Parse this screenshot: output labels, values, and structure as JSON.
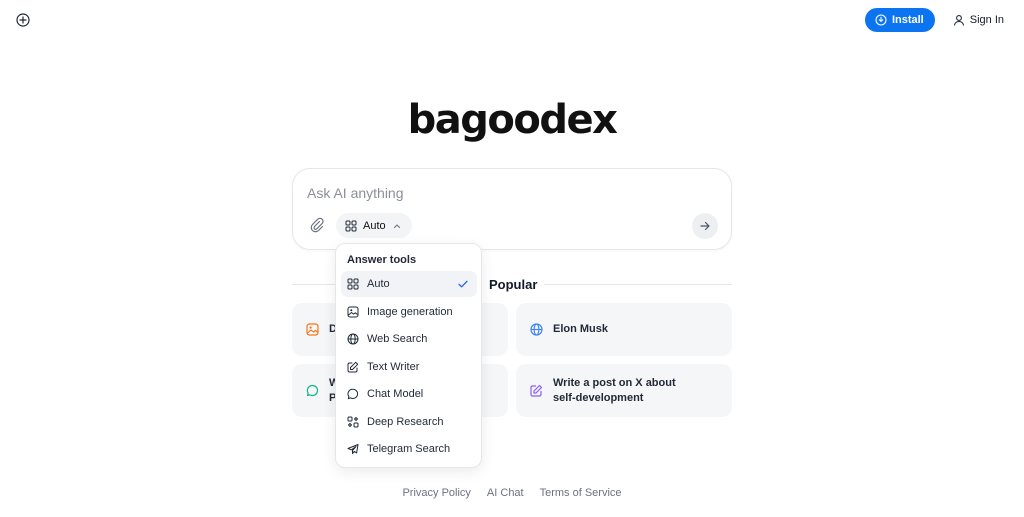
{
  "header": {
    "install_label": "Install",
    "signin_label": "Sign In"
  },
  "logo_text": "bagoodex",
  "search": {
    "placeholder": "Ask AI anything",
    "mode_label": "Auto"
  },
  "popular": {
    "title": "Popular",
    "cards": [
      {
        "label": "D",
        "icon": "image-icon"
      },
      {
        "label": "Elon Musk",
        "icon": "globe-icon"
      },
      {
        "label": "W\nP",
        "icon": "chat-icon"
      },
      {
        "label": "Write a post on X about self-development",
        "icon": "edit-icon"
      }
    ]
  },
  "dropdown": {
    "title": "Answer tools",
    "items": [
      {
        "label": "Auto",
        "icon": "grid-icon",
        "selected": true
      },
      {
        "label": "Image generation",
        "icon": "image-icon"
      },
      {
        "label": "Web Search",
        "icon": "globe-icon"
      },
      {
        "label": "Text Writer",
        "icon": "edit-icon"
      },
      {
        "label": "Chat Model",
        "icon": "chat-icon"
      },
      {
        "label": "Deep Research",
        "icon": "research-icon"
      },
      {
        "label": "Telegram Search",
        "icon": "telegram-icon"
      }
    ]
  },
  "footer": {
    "privacy": "Privacy Policy",
    "ai_chat": "AI Chat",
    "terms": "Terms of Service"
  },
  "colors": {
    "accent": "#0b74f1",
    "orange": "#f97316",
    "blue": "#3b82f6",
    "green": "#10b981",
    "purple": "#8b5cf6"
  }
}
